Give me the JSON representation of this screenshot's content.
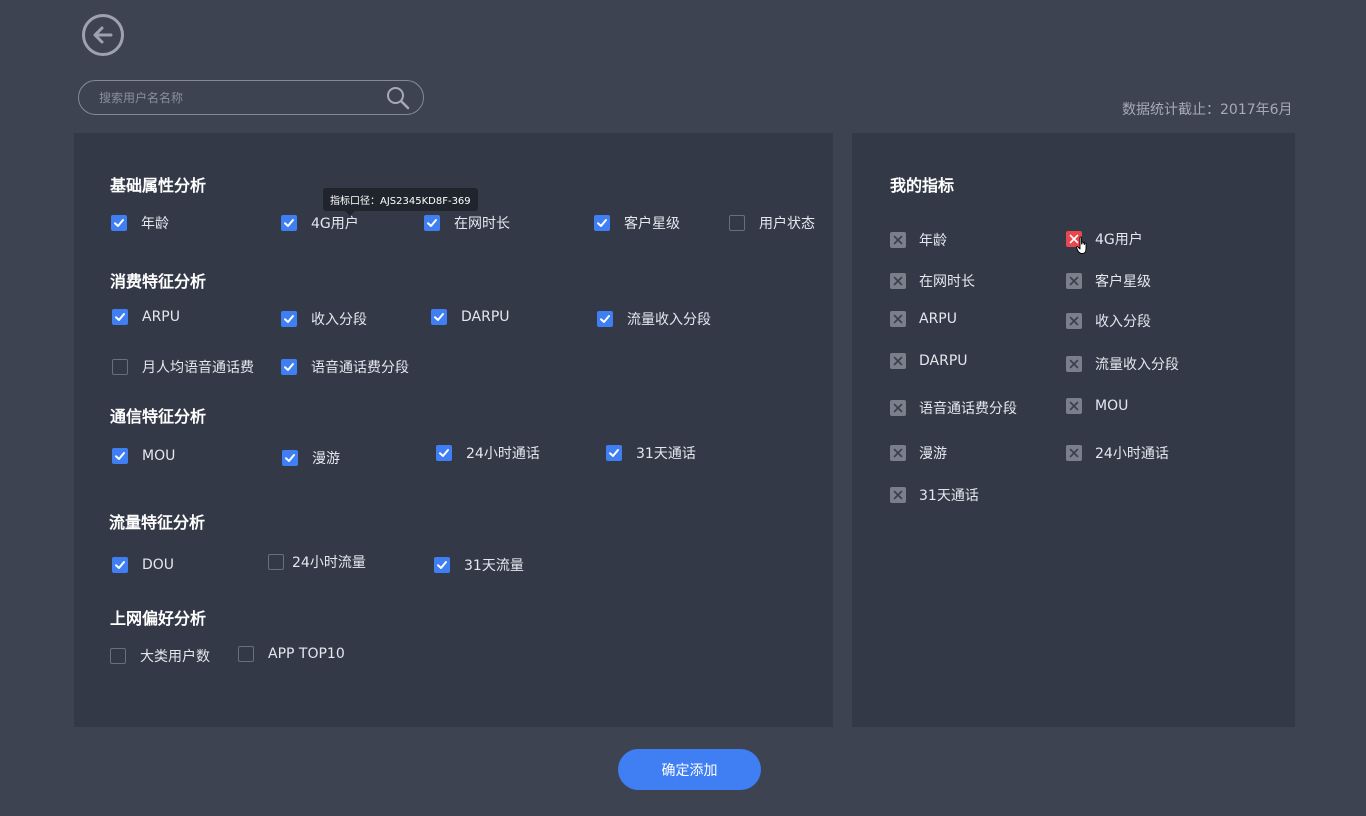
{
  "search": {
    "placeholder": "搜索用户名名称"
  },
  "stat_date": "数据统计截止：2017年6月",
  "tooltip": "指标口径：AJS2345KD8F-369",
  "sections": {
    "basic": {
      "title": "基础属性分析",
      "items": [
        {
          "label": "年龄",
          "checked": true
        },
        {
          "label": "4G用户",
          "checked": true
        },
        {
          "label": "在网时长",
          "checked": true
        },
        {
          "label": "客户星级",
          "checked": true
        },
        {
          "label": "用户状态",
          "checked": false
        }
      ]
    },
    "consumption": {
      "title": "消费特征分析",
      "items": [
        {
          "label": "ARPU",
          "checked": true
        },
        {
          "label": "收入分段",
          "checked": true
        },
        {
          "label": "DARPU",
          "checked": true
        },
        {
          "label": "流量收入分段",
          "checked": true
        },
        {
          "label": "月人均语音通话费",
          "checked": false
        },
        {
          "label": "语音通话费分段",
          "checked": true
        }
      ]
    },
    "communication": {
      "title": "通信特征分析",
      "items": [
        {
          "label": "MOU",
          "checked": true
        },
        {
          "label": "漫游",
          "checked": true
        },
        {
          "label": "24小时通话",
          "checked": true
        },
        {
          "label": "31天通话",
          "checked": true
        }
      ]
    },
    "traffic": {
      "title": "流量特征分析",
      "items": [
        {
          "label": "DOU",
          "checked": true
        },
        {
          "label": "24小时流量",
          "checked": false
        },
        {
          "label": "31天流量",
          "checked": true
        }
      ]
    },
    "internet": {
      "title": "上网偏好分析",
      "items": [
        {
          "label": "大类用户数",
          "checked": false
        },
        {
          "label": "APP TOP10",
          "checked": false
        }
      ]
    }
  },
  "my_metrics": {
    "title": "我的指标",
    "items": [
      "年龄",
      "4G用户",
      "在网时长",
      "客户星级",
      "ARPU",
      "收入分段",
      "DARPU",
      "流量收入分段",
      "语音通话费分段",
      "MOU",
      "漫游",
      "24小时通话",
      "31天通话"
    ]
  },
  "confirm_label": "确定添加",
  "colors": {
    "background": "#3e4352",
    "panel": "#343947",
    "accent": "#3f7ff3",
    "remove_hover": "#e9474f",
    "remove": "#7a7f8b"
  },
  "icons": {
    "back": "arrow-left-circle-icon",
    "search": "search-icon",
    "remove": "close-icon",
    "cursor": "hand-cursor-icon"
  }
}
